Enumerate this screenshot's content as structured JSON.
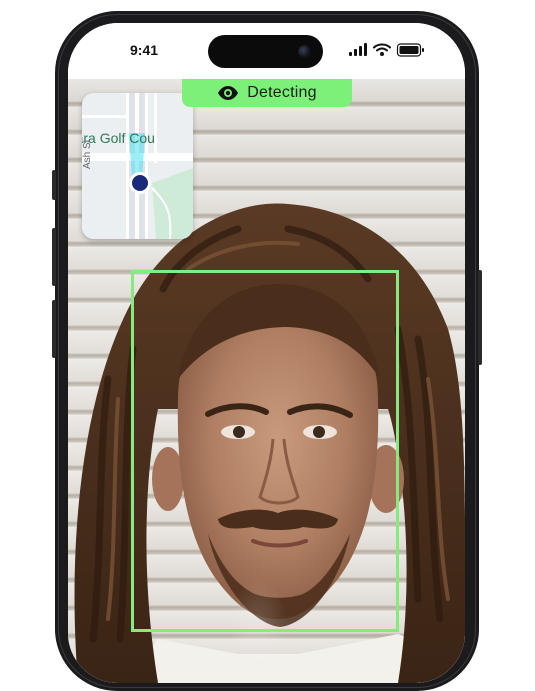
{
  "status_bar": {
    "time": "9:41",
    "icons": [
      "cellular-signal-icon",
      "wifi-icon",
      "battery-icon"
    ]
  },
  "detection": {
    "status_label": "Detecting",
    "icon": "eye-icon",
    "accent_color": "#7df07a",
    "box_color": "#86ea7f"
  },
  "mini_map": {
    "place_label": "ngara Golf Cou",
    "street_label": "Ash St",
    "location_marker_color": "#1a2a7a",
    "park_color": "#cdebd6"
  }
}
